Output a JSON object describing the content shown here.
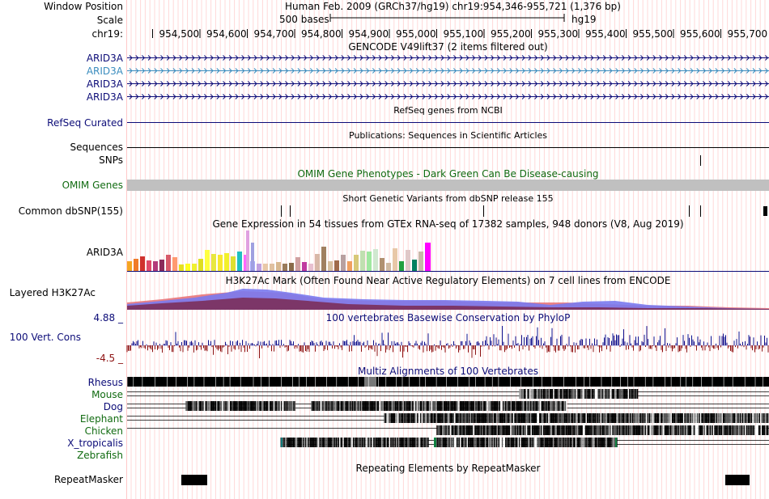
{
  "header": {
    "window_position_label": "Window Position",
    "window_position_value": "Human Feb. 2009 (GRCh37/hg19)   chr19:954,346-955,721 (1,376 bp)",
    "scale_label": "Scale",
    "scale_bar_text": "500 bases",
    "scale_assembly": "hg19",
    "chrom_label": "chr19:",
    "ruler_ticks": [
      "954,500",
      "954,600",
      "954,700",
      "954,800",
      "954,900",
      "955,000",
      "955,100",
      "955,200",
      "955,300",
      "955,400",
      "955,500",
      "955,600",
      "955,700"
    ]
  },
  "gencode": {
    "title": "GENCODE V49lift37 (2 items filtered out)",
    "transcripts": [
      "ARID3A",
      "ARID3A",
      "ARID3A",
      "ARID3A"
    ]
  },
  "refseq": {
    "title": "RefSeq genes from NCBI",
    "label": "RefSeq Curated"
  },
  "publications": {
    "title": "Publications: Sequences in Scientific Articles",
    "label": "Sequences"
  },
  "snps": {
    "label": "SNPs"
  },
  "omim": {
    "title": "OMIM Gene Phenotypes - Dark Green Can Be Disease-causing",
    "label": "OMIM Genes"
  },
  "dbsnp": {
    "title": "Short Genetic Variants from dbSNP release 155",
    "label": "Common dbSNP(155)"
  },
  "gtex": {
    "title": "Gene Expression in 54 tissues from GTEx RNA-seq of 17382 samples, 948 donors (V8, Aug 2019)",
    "label": "ARID3A"
  },
  "h3k27ac": {
    "title": "H3K27Ac Mark (Often Found Near Active Regulatory Elements) on 7 cell lines from ENCODE",
    "label": "Layered H3K27Ac"
  },
  "phylop": {
    "title": "100 vertebrates Basewise Conservation by PhyloP",
    "label": "100 Vert. Cons",
    "max_label": "4.88 _",
    "min_label": "-4.5 _"
  },
  "multiz": {
    "title": "Multiz Alignments of 100 Vertebrates",
    "species": [
      "Rhesus",
      "Mouse",
      "Dog",
      "Elephant",
      "Chicken",
      "X_tropicalis",
      "Zebrafish"
    ]
  },
  "repeatmasker": {
    "title": "Repeating Elements by RepeatMasker",
    "label": "RepeatMasker"
  },
  "colors": {
    "navy": "#0c0c78",
    "gencode_alt": "#3a8cbe",
    "omim_green": "#116b11",
    "omim_bar": "#c0c0c0",
    "grid": "#ffc8c8",
    "conservation": "#10108c",
    "nonconserved": "#8c1010"
  }
}
